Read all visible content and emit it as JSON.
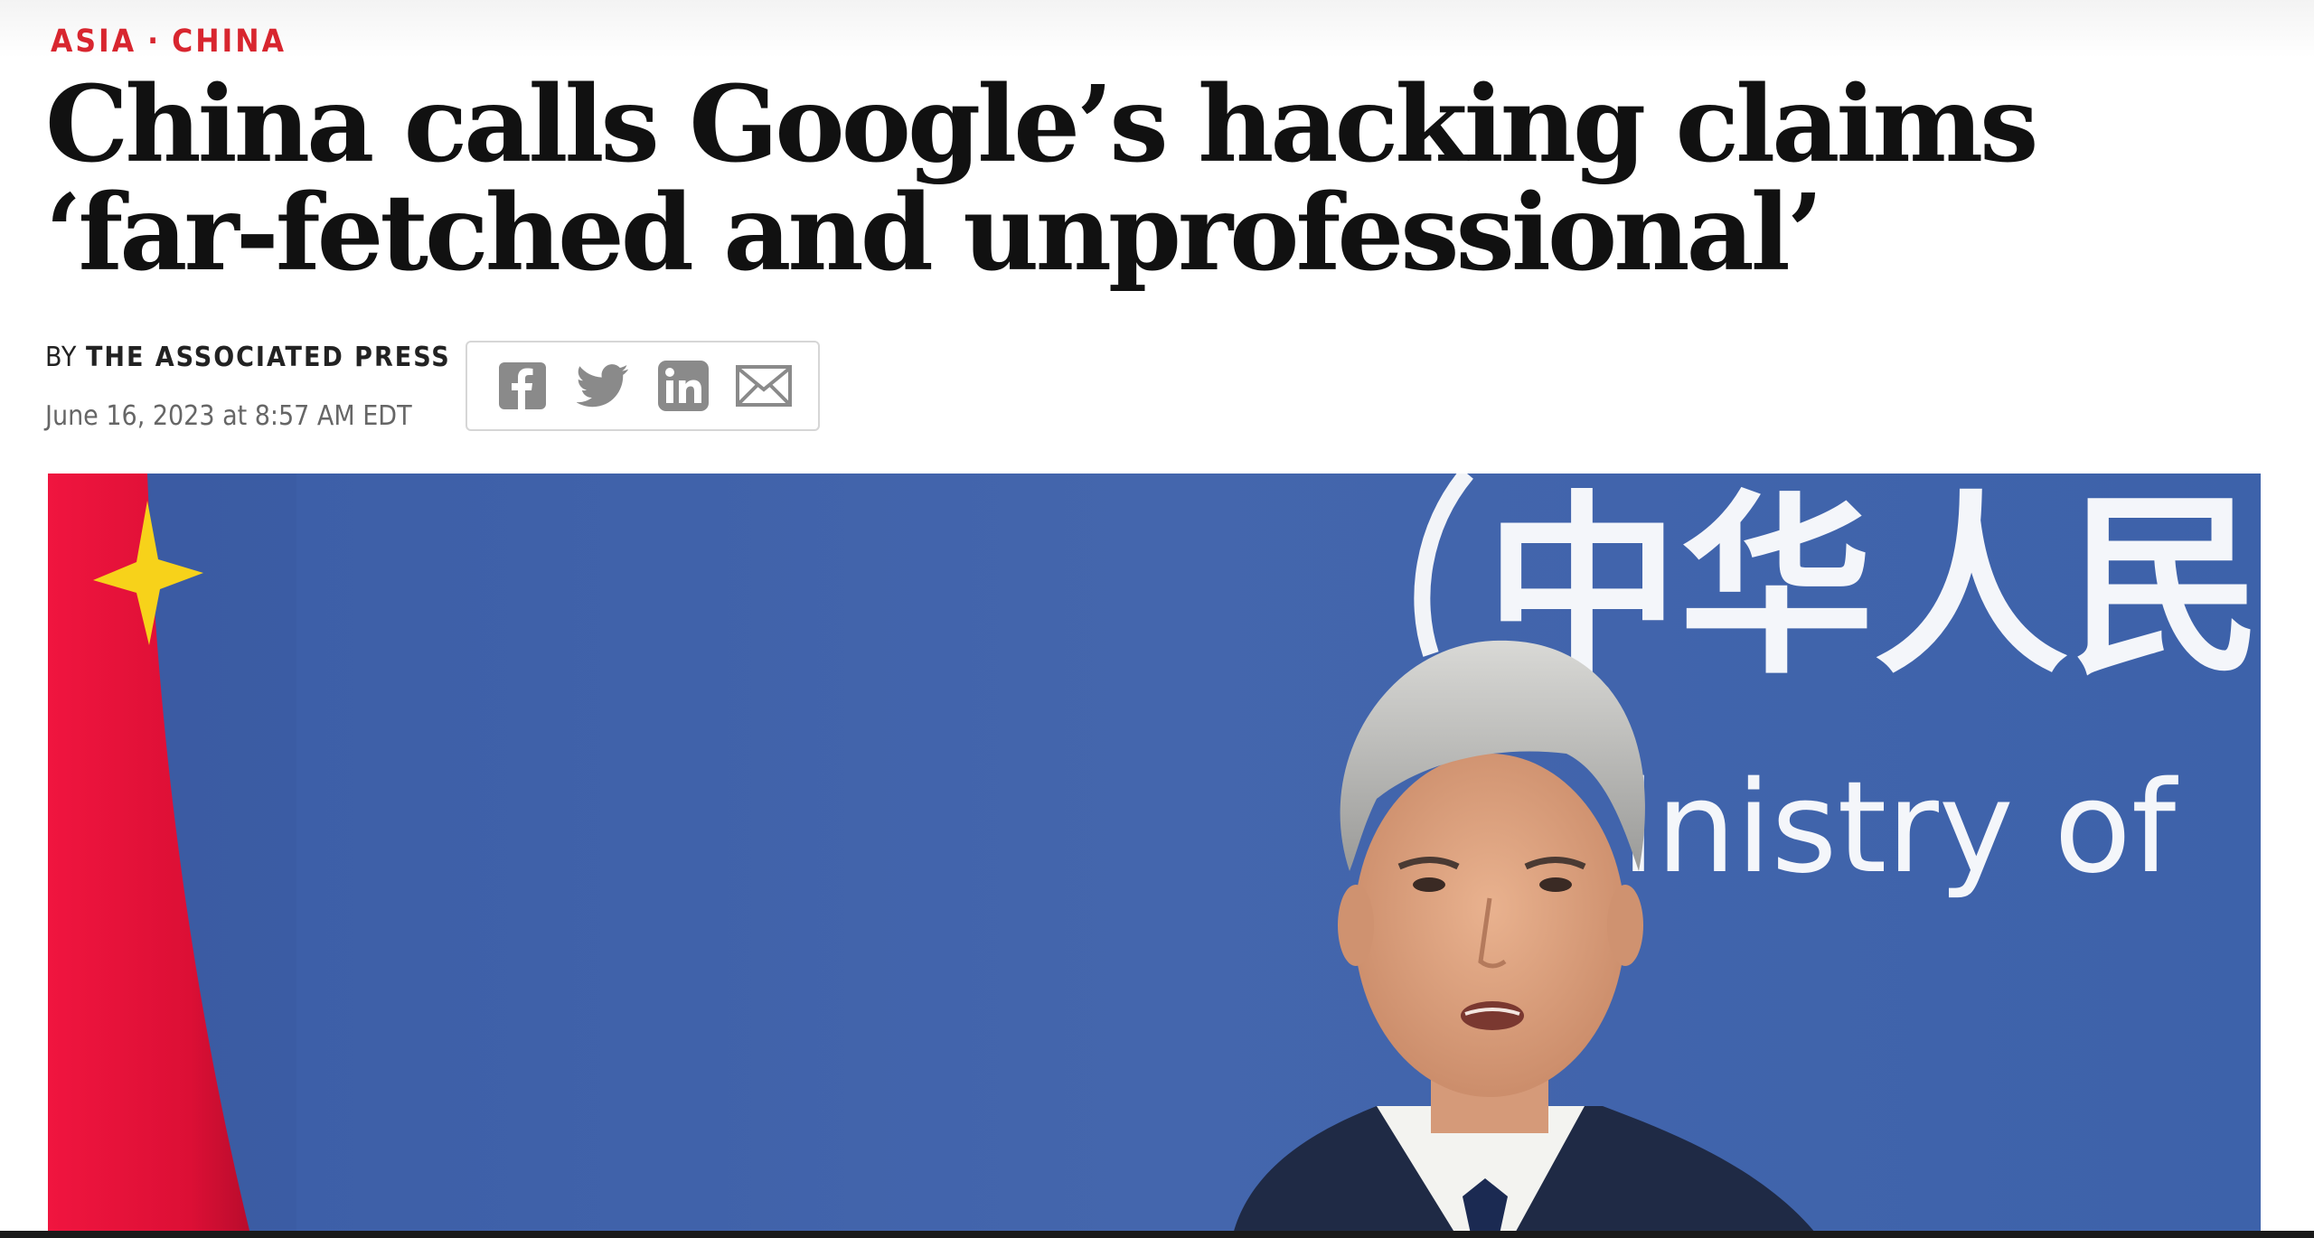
{
  "article": {
    "section": "ASIA",
    "separator": "·",
    "subsection": "CHINA",
    "headline": "China calls Google’s hacking claims ‘far-fetched and unprofessional’",
    "byline_prefix": "BY",
    "author": "THE ASSOCIATED PRESS",
    "date": "June 16, 2023 at 8:57 AM EDT"
  },
  "share": {
    "icons": [
      "facebook-icon",
      "twitter-icon",
      "linkedin-icon",
      "email-icon"
    ]
  },
  "hero": {
    "backdrop_characters": "中华人民",
    "backdrop_text": "inistry of"
  },
  "colors": {
    "kicker": "#d8262f",
    "headline": "#111111",
    "backdrop_blue": "#3f61a8",
    "flag_red": "#e8123a",
    "flag_star": "#f7d21a",
    "icon_gray": "#8a8a8a"
  }
}
